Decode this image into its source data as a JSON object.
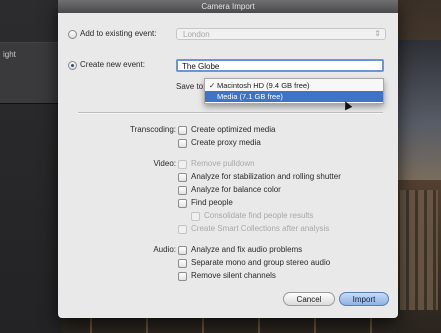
{
  "window": {
    "title": "Camera Import"
  },
  "background": {
    "sidebar_text": "ight"
  },
  "options": {
    "add_existing_label": "Add to existing event:",
    "existing_event_value": "London",
    "create_new_label": "Create new event:",
    "new_event_value": "The Globe",
    "save_to_label": "Save to:"
  },
  "save_menu": {
    "items": [
      {
        "check": "✓",
        "label": "Macintosh HD  (9.4 GB free)"
      },
      {
        "check": "",
        "label": "Media  (7.1 GB free)"
      }
    ]
  },
  "transcoding": {
    "label": "Transcoding:",
    "optimized": "Create optimized media",
    "proxy": "Create proxy media"
  },
  "video": {
    "label": "Video:",
    "pulldown": "Remove pulldown",
    "stabilization": "Analyze for stabilization and rolling shutter",
    "balance": "Analyze for balance color",
    "people": "Find people",
    "consolidate": "Consolidate find people results",
    "smart_collections": "Create Smart Collections after analysis"
  },
  "audio": {
    "label": "Audio:",
    "fix": "Analyze and fix audio problems",
    "mono": "Separate mono and group stereo audio",
    "silent": "Remove silent channels"
  },
  "buttons": {
    "cancel": "Cancel",
    "import": "Import"
  },
  "colors": {
    "selection": "#3f73c8",
    "dialog_bg": "#e9e9ea",
    "focus_ring": "#6d95d6"
  }
}
